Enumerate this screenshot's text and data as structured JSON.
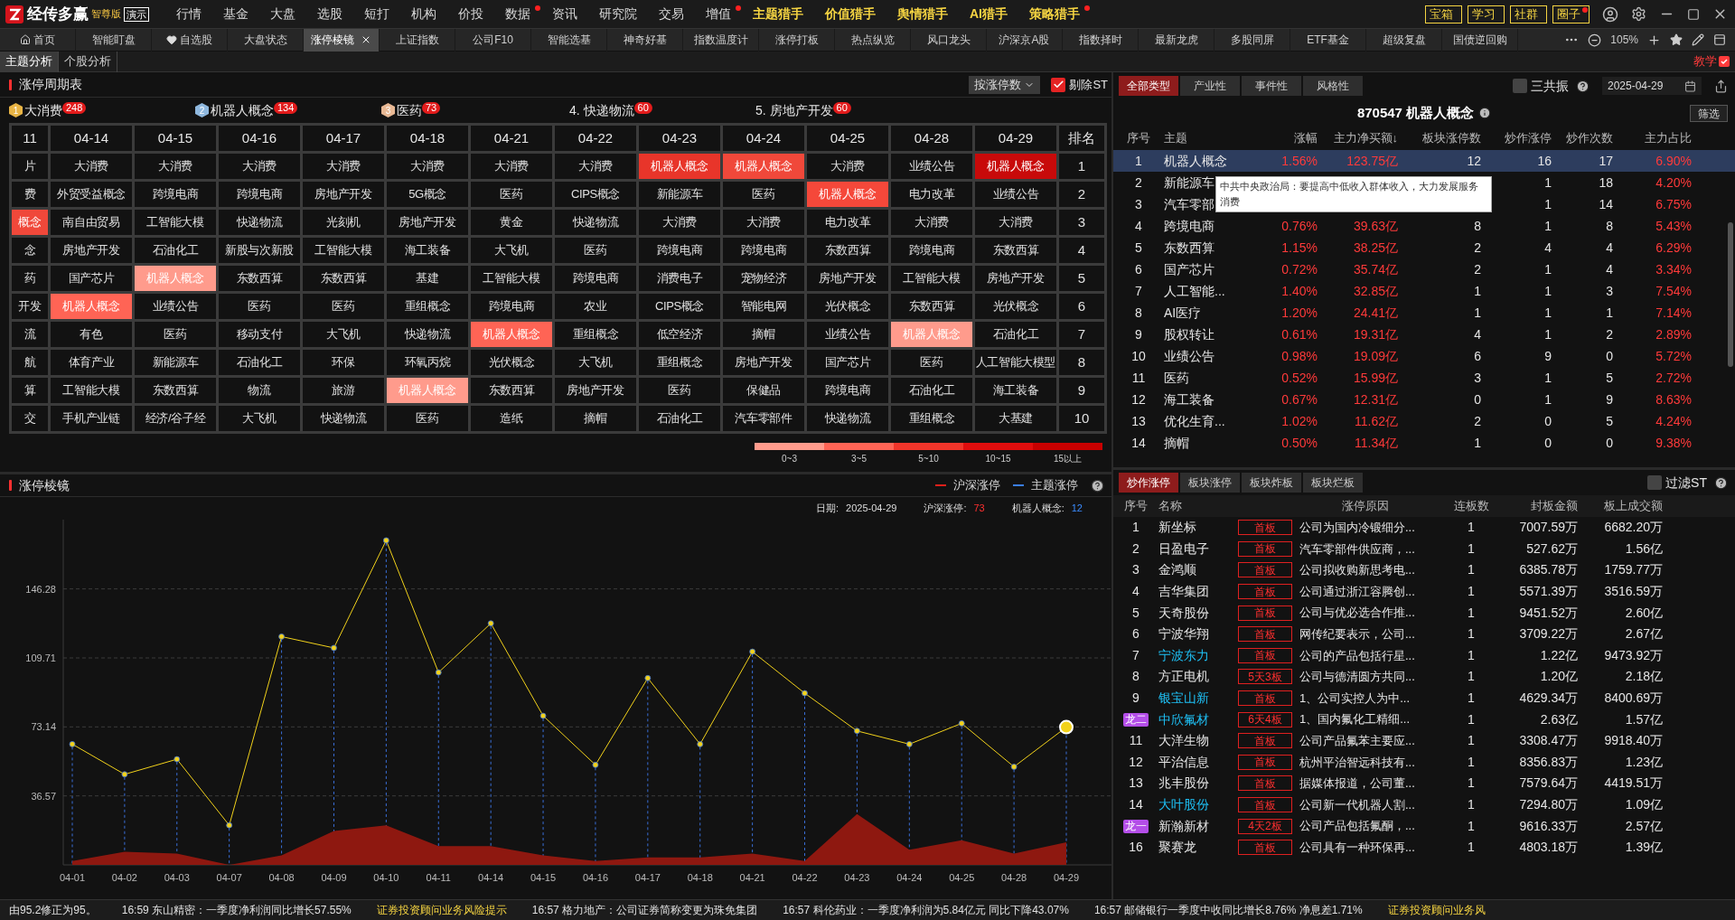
{
  "app": {
    "name": "经传多赢",
    "edition": "智尊版",
    "demo": "演示"
  },
  "menu": [
    {
      "label": "行情",
      "kind": "normal",
      "dot": false
    },
    {
      "label": "基金",
      "kind": "normal",
      "dot": false
    },
    {
      "label": "大盘",
      "kind": "normal",
      "dot": false
    },
    {
      "label": "选股",
      "kind": "normal",
      "dot": false
    },
    {
      "label": "短打",
      "kind": "normal",
      "dot": false
    },
    {
      "label": "机构",
      "kind": "normal",
      "dot": false
    },
    {
      "label": "价投",
      "kind": "normal",
      "dot": false
    },
    {
      "label": "数据",
      "kind": "normal",
      "dot": true
    },
    {
      "label": "资讯",
      "kind": "normal",
      "dot": false
    },
    {
      "label": "研究院",
      "kind": "normal",
      "dot": false
    },
    {
      "label": "交易",
      "kind": "normal",
      "dot": false
    },
    {
      "label": "增值",
      "kind": "normal",
      "dot": true
    },
    {
      "label": "主题猎手",
      "kind": "hunter",
      "dot": false
    },
    {
      "label": "价值猎手",
      "kind": "hunter",
      "dot": false
    },
    {
      "label": "舆情猎手",
      "kind": "hunter",
      "dot": false
    },
    {
      "label": "AI猎手",
      "kind": "hunter",
      "dot": false
    },
    {
      "label": "策略猎手",
      "kind": "hunter",
      "dot": true
    }
  ],
  "quick_buttons": [
    {
      "label": "宝箱",
      "dot": false
    },
    {
      "label": "学习",
      "dot": false
    },
    {
      "label": "社群",
      "dot": false
    },
    {
      "label": "圈子",
      "dot": true
    }
  ],
  "tabs": [
    {
      "label": "首页",
      "selected": false
    },
    {
      "label": "智能盯盘",
      "selected": false
    },
    {
      "label": "自选股",
      "selected": false
    },
    {
      "label": "大盘状态",
      "selected": false
    },
    {
      "label": "涨停棱镜",
      "selected": true
    },
    {
      "label": "上证指数",
      "selected": false
    },
    {
      "label": "公司F10",
      "selected": false
    },
    {
      "label": "智能选基",
      "selected": false
    },
    {
      "label": "神奇好基",
      "selected": false
    },
    {
      "label": "指数温度计",
      "selected": false
    },
    {
      "label": "涨停打板",
      "selected": false
    },
    {
      "label": "热点纵览",
      "selected": false
    },
    {
      "label": "风口龙头",
      "selected": false
    },
    {
      "label": "沪深京A股",
      "selected": false
    },
    {
      "label": "指数择时",
      "selected": false
    },
    {
      "label": "最新龙虎",
      "selected": false
    },
    {
      "label": "多股同屏",
      "selected": false
    },
    {
      "label": "ETF基金",
      "selected": false
    },
    {
      "label": "超级复盘",
      "selected": false
    },
    {
      "label": "国债逆回购",
      "selected": false
    }
  ],
  "zoom": "105%",
  "sub_tabs": [
    {
      "label": "主题分析",
      "selected": true
    },
    {
      "label": "个股分析",
      "selected": false
    }
  ],
  "teach": "教学",
  "cycle_table": {
    "title": "涨停周期表",
    "sort": "按涨停数",
    "exclude_st": {
      "label": "剔除ST",
      "checked": true
    },
    "top_themes": [
      {
        "kind": "medal",
        "rank": "1",
        "name": "大消费",
        "count": "248",
        "color": "#e8b445"
      },
      {
        "kind": "medal",
        "rank": "2",
        "name": "机器人概念",
        "count": "134",
        "color": "#8fb8de"
      },
      {
        "kind": "medal",
        "rank": "3",
        "name": "医药",
        "count": "73",
        "color": "#e8b894"
      },
      {
        "kind": "plain",
        "name": "4. 快递物流",
        "count": "60"
      },
      {
        "kind": "plain",
        "name": "5. 房地产开发",
        "count": "60"
      }
    ],
    "columns": [
      "11",
      "04-14",
      "04-15",
      "04-16",
      "04-17",
      "04-18",
      "04-21",
      "04-22",
      "04-23",
      "04-24",
      "04-25",
      "04-28",
      "04-29",
      "排名"
    ],
    "rows": [
      {
        "rank": "1",
        "cells": [
          "片",
          "大消费",
          "大消费",
          "大消费",
          "大消费",
          "大消费",
          "大消费",
          "大消费",
          {
            "text": "机器人概念",
            "color": "#e8352a"
          },
          {
            "text": "机器人概念",
            "color": "#f0483a"
          },
          "大消费",
          "业绩公告",
          {
            "text": "机器人概念",
            "color": "#c80a0a"
          }
        ]
      },
      {
        "rank": "2",
        "cells": [
          "费",
          "外贸受益概念",
          "跨境电商",
          "跨境电商",
          "房地产开发",
          "5G概念",
          "医药",
          "CIPS概念",
          "新能源车",
          "医药",
          {
            "text": "机器人概念",
            "color": "#f5483a"
          },
          "电力改革",
          "业绩公告"
        ]
      },
      {
        "rank": "3",
        "cells": [
          {
            "text": "概念",
            "color": "#f0483a"
          },
          "南自由贸易",
          "工智能大模",
          "快递物流",
          "光刻机",
          "房地产开发",
          "黄金",
          "快递物流",
          "大消费",
          "大消费",
          "电力改革",
          "大消费",
          "大消费"
        ]
      },
      {
        "rank": "4",
        "cells": [
          "念",
          "房地产开发",
          "石油化工",
          "新股与次新股",
          "工智能大模",
          "海工装备",
          "大飞机",
          "医药",
          "跨境电商",
          "跨境电商",
          "东数西算",
          "跨境电商",
          "东数西算"
        ]
      },
      {
        "rank": "5",
        "cells": [
          "药",
          "国产芯片",
          {
            "text": "机器人概念",
            "color": "#ff9b8c"
          },
          "东数西算",
          "东数西算",
          "基建",
          "工智能大模",
          "跨境电商",
          "消费电子",
          "宠物经济",
          "房地产开发",
          "工智能大模",
          "房地产开发"
        ]
      },
      {
        "rank": "6",
        "cells": [
          "开发",
          {
            "text": "机器人概念",
            "color": "#ff6455"
          },
          "业绩公告",
          "医药",
          "医药",
          "重组概念",
          "跨境电商",
          "农业",
          "CIPS概念",
          "智能电网",
          "光伏概念",
          "东数西算",
          "光伏概念"
        ]
      },
      {
        "rank": "7",
        "cells": [
          "流",
          "有色",
          "医药",
          "移动支付",
          "大飞机",
          "快递物流",
          {
            "text": "机器人概念",
            "color": "#ff6455"
          },
          "重组概念",
          "低空经济",
          "摘帽",
          "业绩公告",
          {
            "text": "机器人概念",
            "color": "#ff9b8c"
          },
          "石油化工"
        ]
      },
      {
        "rank": "8",
        "cells": [
          "航",
          "体育产业",
          "新能源车",
          "石油化工",
          "环保",
          "环氧丙烷",
          "光伏概念",
          "大飞机",
          "重组概念",
          "房地产开发",
          "国产芯片",
          "医药",
          "人工智能大模型"
        ]
      },
      {
        "rank": "9",
        "cells": [
          "算",
          "工智能大模",
          "东数西算",
          "物流",
          "旅游",
          {
            "text": "机器人概念",
            "color": "#ff9b8c"
          },
          "东数西算",
          "房地产开发",
          "医药",
          "保健品",
          "跨境电商",
          "石油化工",
          "海工装备"
        ]
      },
      {
        "rank": "10",
        "cells": [
          "交",
          "手机产业链",
          "经济/谷子经",
          "大飞机",
          "快递物流",
          "医药",
          "造纸",
          "摘帽",
          "石油化工",
          "汽车零部件",
          "快递物流",
          "重组概念",
          "大基建"
        ]
      }
    ],
    "legend": [
      {
        "label": "0~3",
        "color": "#ff9b8c"
      },
      {
        "label": "3~5",
        "color": "#ff6455"
      },
      {
        "label": "5~10",
        "color": "#f0352a"
      },
      {
        "label": "10~15",
        "color": "#e00d0d"
      },
      {
        "label": "15以上",
        "color": "#c80000"
      }
    ]
  },
  "prism": {
    "title": "涨停棱镜",
    "legend": [
      {
        "color": "#e0201a"
      },
      {
        "color": "#3a7ee8"
      }
    ],
    "info": [
      {
        "label": "日期:",
        "value": "2025-04-29",
        "kind": "date"
      },
      {
        "label": "沪深涨停:",
        "value": "73",
        "kind": "market"
      },
      {
        "label": "机器人概念:",
        "value": "12",
        "kind": "theme"
      }
    ],
    "chart_data": {
      "type": "line",
      "categories": [
        "04-01",
        "04-02",
        "04-03",
        "04-07",
        "04-08",
        "04-09",
        "04-10",
        "04-11",
        "04-14",
        "04-15",
        "04-16",
        "04-17",
        "04-18",
        "04-21",
        "04-22",
        "04-23",
        "04-24",
        "04-25",
        "04-28",
        "04-29"
      ],
      "ylim": [
        0,
        183
      ],
      "grid": true,
      "yticks": [
        36.57,
        73.14,
        109.71,
        146.28
      ],
      "series": [
        {
          "name": "沪深涨停",
          "type": "line",
          "color": "#f2d21b",
          "marker": "o",
          "values": [
            64,
            48,
            56,
            21,
            121,
            115,
            172,
            102,
            128,
            79,
            53,
            99,
            64,
            113,
            91,
            71,
            64,
            75,
            52,
            73
          ]
        },
        {
          "name": "主题涨停",
          "type": "area",
          "color": "#8e1810",
          "values": [
            2,
            7,
            6,
            0,
            5,
            18,
            21,
            10,
            10,
            5,
            2,
            4,
            4,
            6,
            2,
            27,
            8,
            13,
            6,
            12
          ]
        }
      ]
    }
  },
  "theme_panel": {
    "tabs": [
      {
        "label": "全部类型",
        "selected": true
      },
      {
        "label": "产业性",
        "selected": false
      },
      {
        "label": "事件性",
        "selected": false
      },
      {
        "label": "风格性",
        "selected": false
      }
    ],
    "resonance": {
      "label": "三共振",
      "checked": false
    },
    "date": "2025-04-29",
    "title": "870547 机器人概念",
    "filter": "筛选",
    "columns": [
      "序号",
      "主题",
      "涨幅",
      "主力净买额↓",
      "板块涨停数",
      "炒作涨停",
      "炒作次数",
      "主力占比"
    ],
    "rows": [
      {
        "selected": true,
        "cells": [
          "1",
          "机器人概念",
          "1.56%",
          "123.75亿",
          "12",
          "16",
          "17",
          "6.90%"
        ]
      },
      {
        "selected": false,
        "cells": [
          "2",
          "新能源车",
          null,
          null,
          null,
          "1",
          "18",
          "4.20%"
        ]
      },
      {
        "selected": false,
        "cells": [
          "3",
          "汽车零部",
          null,
          null,
          null,
          "1",
          "14",
          "6.75%"
        ]
      },
      {
        "selected": false,
        "cells": [
          "4",
          "跨境电商",
          "0.76%",
          "39.63亿",
          "8",
          "1",
          "8",
          "5.43%"
        ]
      },
      {
        "selected": false,
        "cells": [
          "5",
          "东数西算",
          "1.15%",
          "38.25亿",
          "2",
          "4",
          "4",
          "6.29%"
        ]
      },
      {
        "selected": false,
        "cells": [
          "6",
          "国产芯片",
          "0.72%",
          "35.74亿",
          "2",
          "1",
          "4",
          "3.34%"
        ]
      },
      {
        "selected": false,
        "cells": [
          "7",
          "人工智能...",
          "1.40%",
          "32.85亿",
          "1",
          "1",
          "3",
          "7.54%"
        ]
      },
      {
        "selected": false,
        "cells": [
          "8",
          "AI医疗",
          "1.20%",
          "24.41亿",
          "1",
          "1",
          "1",
          "7.14%"
        ]
      },
      {
        "selected": false,
        "cells": [
          "9",
          "股权转让",
          "0.61%",
          "19.31亿",
          "4",
          "1",
          "2",
          "2.89%"
        ]
      },
      {
        "selected": false,
        "cells": [
          "10",
          "业绩公告",
          "0.98%",
          "19.09亿",
          "6",
          "9",
          "0",
          "5.72%"
        ]
      },
      {
        "selected": false,
        "cells": [
          "11",
          "医药",
          "0.52%",
          "15.99亿",
          "3",
          "1",
          "5",
          "2.72%"
        ]
      },
      {
        "selected": false,
        "cells": [
          "12",
          "海工装备",
          "0.67%",
          "12.31亿",
          "0",
          "1",
          "9",
          "8.63%"
        ]
      },
      {
        "selected": false,
        "cells": [
          "13",
          "优化生育...",
          "1.02%",
          "11.62亿",
          "2",
          "0",
          "5",
          "4.24%"
        ]
      },
      {
        "selected": false,
        "cells": [
          "14",
          "摘帽",
          "0.50%",
          "11.34亿",
          "1",
          "0",
          "0",
          "9.38%"
        ]
      }
    ],
    "tooltip": "中共中央政治局：要提高中低收入群体收入，大力发展服务消费"
  },
  "stock_panel": {
    "tabs": [
      {
        "label": "炒作涨停",
        "selected": true
      },
      {
        "label": "板块涨停",
        "selected": false
      },
      {
        "label": "板块炸板",
        "selected": false
      },
      {
        "label": "板块烂板",
        "selected": false
      }
    ],
    "filter_st": {
      "label": "过滤ST",
      "checked": false
    },
    "columns": [
      "序号",
      "名称",
      "涨停原因",
      "连板数",
      "封板金额",
      "板上成交额"
    ],
    "rows": [
      {
        "no": "1",
        "name": "新坐标",
        "color": "#e6e6e6",
        "tag": "首板",
        "reason": "公司为国内冷锻细分...",
        "streak": "1",
        "seal": "7007.59万",
        "turnover": "6682.20万"
      },
      {
        "no": "2",
        "name": "日盈电子",
        "color": "#e6e6e6",
        "tag": "首板",
        "reason": "汽车零部件供应商，...",
        "streak": "1",
        "seal": "527.62万",
        "turnover": "1.56亿"
      },
      {
        "no": "3",
        "name": "金鸿顺",
        "color": "#e6e6e6",
        "tag": "首板",
        "reason": "公司拟收购新思考电...",
        "streak": "1",
        "seal": "6385.78万",
        "turnover": "1759.77万"
      },
      {
        "no": "4",
        "name": "吉华集团",
        "color": "#e6e6e6",
        "tag": "首板",
        "reason": "公司通过浙江容腾创...",
        "streak": "1",
        "seal": "5571.39万",
        "turnover": "3516.59万"
      },
      {
        "no": "5",
        "name": "天奇股份",
        "color": "#e6e6e6",
        "tag": "首板",
        "reason": "公司与优必选合作推...",
        "streak": "1",
        "seal": "9451.52万",
        "turnover": "2.60亿"
      },
      {
        "no": "6",
        "name": "宁波华翔",
        "color": "#e6e6e6",
        "tag": "首板",
        "reason": "网传纪要表示，公司...",
        "streak": "1",
        "seal": "3709.22万",
        "turnover": "2.67亿"
      },
      {
        "no": "7",
        "name": "宁波东力",
        "color": "#1ec0f5",
        "tag": "首板",
        "reason": "公司的产品包括行星...",
        "streak": "1",
        "seal": "1.22亿",
        "turnover": "9473.92万"
      },
      {
        "no": "8",
        "name": "方正电机",
        "color": "#e6e6e6",
        "tag": "5天3板",
        "reason": "公司与德清圆方共同...",
        "streak": "1",
        "seal": "1.20亿",
        "turnover": "2.18亿"
      },
      {
        "no": "9",
        "name": "银宝山新",
        "color": "#1ec0f5",
        "tag": "首板",
        "reason": "1、公司实控人为中...",
        "streak": "1",
        "seal": "4629.34万",
        "turnover": "8400.69万"
      },
      {
        "badge": "龙二",
        "name": "中欣氟材",
        "color": "#1ec0f5",
        "tag": "6天4板",
        "reason": "1、国内氟化工精细...",
        "streak": "1",
        "seal": "2.63亿",
        "turnover": "1.57亿"
      },
      {
        "no": "11",
        "name": "大洋生物",
        "color": "#e6e6e6",
        "tag": "首板",
        "reason": "公司产品氟苯主要应...",
        "streak": "1",
        "seal": "3308.47万",
        "turnover": "9918.40万"
      },
      {
        "no": "12",
        "name": "平治信息",
        "color": "#e6e6e6",
        "tag": "首板",
        "reason": "杭州平治智远科技有...",
        "streak": "1",
        "seal": "8356.83万",
        "turnover": "1.23亿"
      },
      {
        "no": "13",
        "name": "兆丰股份",
        "color": "#e6e6e6",
        "tag": "首板",
        "reason": "据媒体报道，公司董...",
        "streak": "1",
        "seal": "7579.64万",
        "turnover": "4419.51万"
      },
      {
        "no": "14",
        "name": "大叶股份",
        "color": "#1ec0f5",
        "tag": "首板",
        "reason": "公司新一代机器人割...",
        "streak": "1",
        "seal": "7294.80万",
        "turnover": "1.09亿"
      },
      {
        "badge": "龙一",
        "name": "新瀚新材",
        "color": "#e6e6e6",
        "tag": "4天2板",
        "reason": "公司产品包括氟酮，...",
        "streak": "1",
        "seal": "9616.33万",
        "turnover": "2.57亿"
      },
      {
        "no": "16",
        "name": "聚赛龙",
        "color": "#e6e6e6",
        "tag": "首板",
        "reason": "公司具有一种环保再...",
        "streak": "1",
        "seal": "4803.18万",
        "turnover": "1.39亿"
      }
    ]
  },
  "ticker": [
    {
      "kind": "news",
      "text": "由95.2修正为95。"
    },
    {
      "kind": "news",
      "text": "16:59 东山精密：一季度净利润同比增长57.55%"
    },
    {
      "kind": "notice",
      "text": "证券投资顾问业务风险提示"
    },
    {
      "kind": "news",
      "text": "16:57 格力地产：公司证券简称变更为珠免集团"
    },
    {
      "kind": "news",
      "text": "16:57 科伦药业：一季度净利润为5.84亿元 同比下降43.07%"
    },
    {
      "kind": "news",
      "text": "16:57 邮储银行一季度中收同比增长8.76% 净息差1.71%"
    },
    {
      "kind": "notice",
      "text": "证券投资顾问业务风"
    }
  ]
}
